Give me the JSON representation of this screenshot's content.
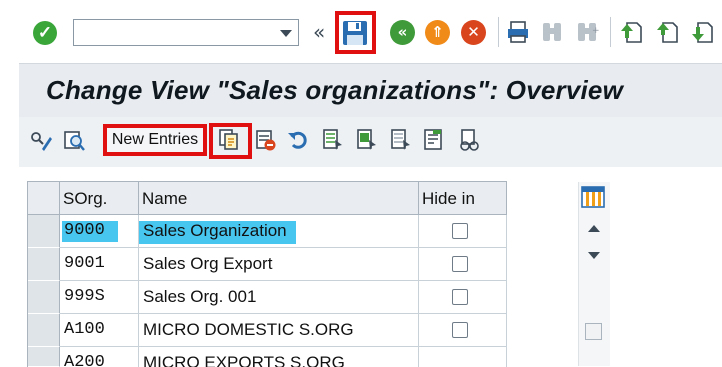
{
  "toolbar": {
    "command_field": {
      "value": "",
      "placeholder": ""
    },
    "icons": [
      "enter-icon",
      "dropdown-icon",
      "double-chevron-icon",
      "save-icon",
      "back-icon",
      "exit-icon",
      "cancel-icon",
      "print-icon",
      "find-icon",
      "find-next-icon",
      "first-page-icon",
      "previous-page-icon",
      "next-page-icon"
    ]
  },
  "title": "Change View \"Sales organizations\": Overview",
  "app_toolbar": {
    "new_entries_label": "New Entries"
  },
  "table": {
    "headers": [
      "SOrg.",
      "Name",
      "Hide in"
    ],
    "rows": [
      {
        "sorg": "9000",
        "name": "Sales Organization",
        "hide": false
      },
      {
        "sorg": "9001",
        "name": "Sales Org Export",
        "hide": false
      },
      {
        "sorg": "999S",
        "name": "Sales Org. 001",
        "hide": false
      },
      {
        "sorg": "A100",
        "name": "MICRO DOMESTIC S.ORG",
        "hide": false
      },
      {
        "sorg": "A200",
        "name": "MICRO EXPORTS S.ORG",
        "hide": false
      }
    ]
  },
  "colors": {
    "annotation_red": "#e01010",
    "highlight_cyan": "#47c6f0",
    "enter_green": "#3aa63a",
    "back_green": "#3f9a3a",
    "exit_orange": "#f08a18",
    "cancel_red": "#d9461e"
  }
}
